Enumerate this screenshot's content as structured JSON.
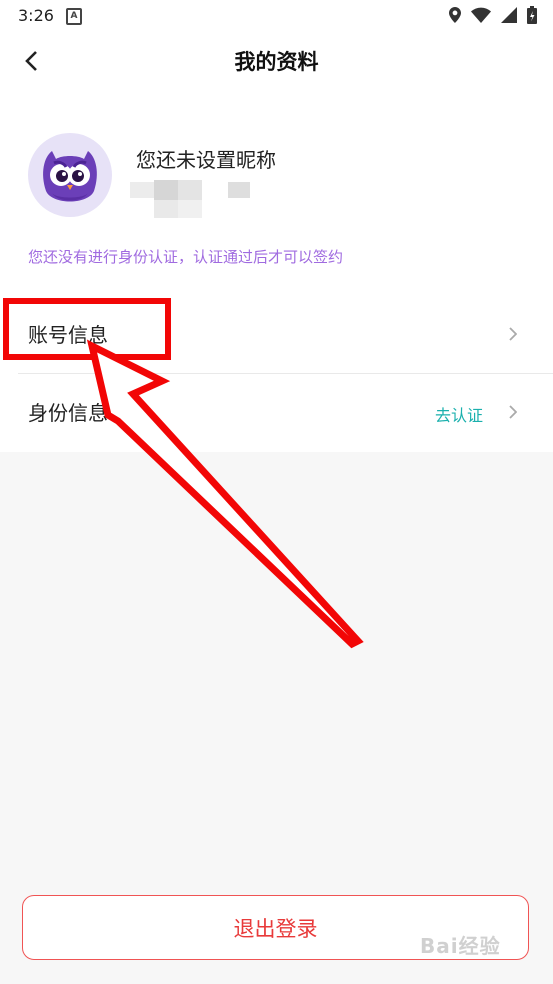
{
  "status_bar": {
    "time": "3:26",
    "notification_letter": "A"
  },
  "header": {
    "title": "我的资料"
  },
  "profile": {
    "nickname": "您还未设置昵称"
  },
  "verify_tip": "您还没有进行身份认证，认证通过后才可以签约",
  "rows": [
    {
      "label": "账号信息",
      "action": ""
    },
    {
      "label": "身份信息",
      "action": "去认证"
    }
  ],
  "logout_label": "退出登录",
  "watermark": "Bai经验",
  "colors": {
    "accent_purple": "#a06be0",
    "action_teal": "#1bb0ad",
    "logout_red": "#e83a3a",
    "annotation_red": "#f20606"
  }
}
